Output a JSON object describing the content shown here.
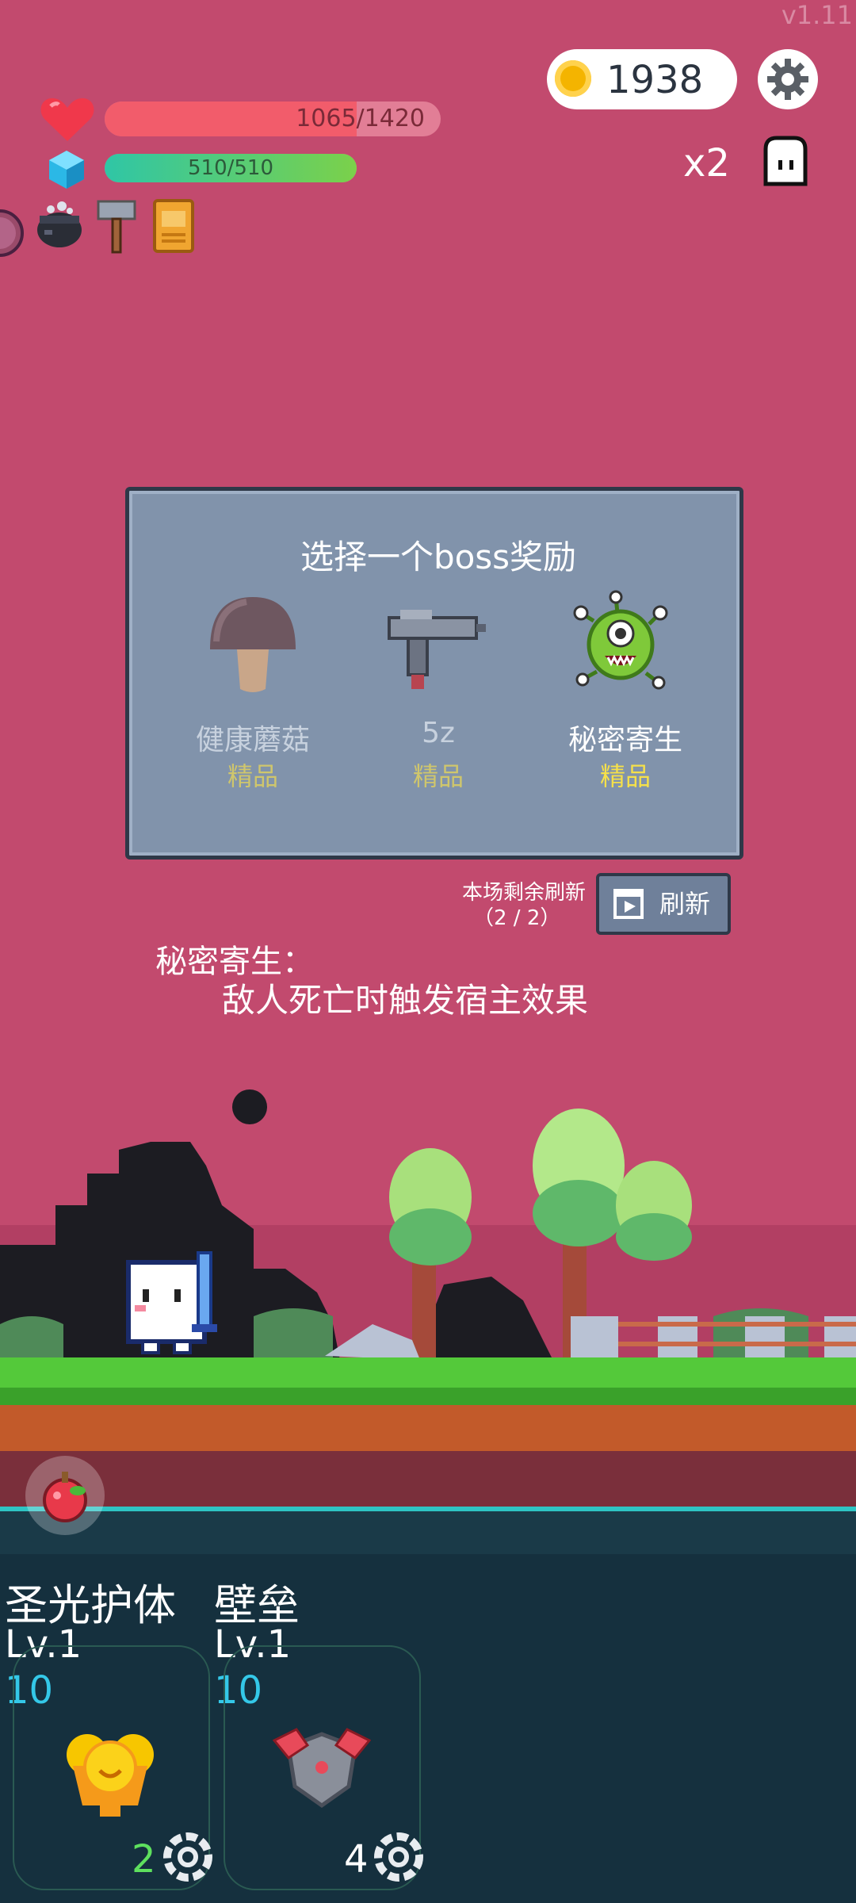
{
  "version": "v1.11",
  "hud": {
    "coins": "1938",
    "hp": {
      "current": 1065,
      "max": 1420,
      "text": "1065/1420",
      "fraction": 0.75
    },
    "mp": {
      "current": 510,
      "max": 510,
      "text": "510/510",
      "fraction": 1.0
    },
    "speed_multiplier": "x2",
    "items": [
      "cauldron-icon",
      "hammer-icon",
      "spellbook-icon"
    ]
  },
  "dialog": {
    "title": "选择一个boss奖励",
    "rewards": [
      {
        "name": "健康蘑菇",
        "quality": "精品",
        "icon": "mushroom-icon",
        "selected": false
      },
      {
        "name": "5z",
        "quality": "精品",
        "icon": "uzi-gun-icon",
        "selected": false
      },
      {
        "name": "秘密寄生",
        "quality": "精品",
        "icon": "parasite-icon",
        "selected": true
      }
    ]
  },
  "refresh": {
    "label_line1": "本场剩余刷新",
    "label_line2": "（2 / 2）",
    "button": "刷新"
  },
  "description": {
    "title": "秘密寄生：",
    "text": "敌人死亡时触发宿主效果"
  },
  "skills": [
    {
      "name": "圣光护体",
      "level": "Lv.1",
      "cost": "10",
      "count": "2",
      "count_color": "#5ee05e",
      "icon": "holy-light-icon"
    },
    {
      "name": "壁垒",
      "level": "Lv.1",
      "cost": "10",
      "count": "4",
      "count_color": "#ffffff",
      "icon": "bulwark-icon"
    }
  ],
  "colors": {
    "sky": "#c24a6e",
    "panel": "#8193ab",
    "hp": "#f25c6b",
    "coin": "#f4b400"
  }
}
